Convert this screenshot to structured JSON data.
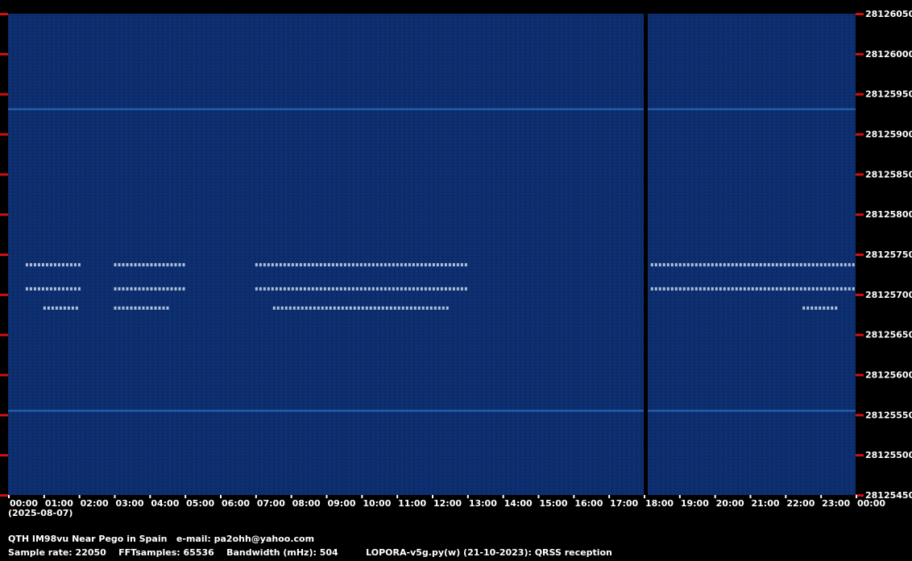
{
  "chart_data": {
    "type": "heatmap",
    "title": "",
    "xlabel": "",
    "ylabel": "",
    "x_tick_labels": [
      "00:00",
      "01:00",
      "02:00",
      "03:00",
      "04:00",
      "05:00",
      "06:00",
      "07:00",
      "08:00",
      "09:00",
      "10:00",
      "11:00",
      "12:00",
      "13:00",
      "14:00",
      "15:00",
      "16:00",
      "17:00",
      "18:00",
      "19:00",
      "20:00",
      "21:00",
      "22:00",
      "23:00",
      "00:00"
    ],
    "x_range_hours": [
      0,
      24
    ],
    "gap_hours": 18,
    "y_tick_labels": [
      "28126050",
      "28126000",
      "28125950",
      "28125900",
      "28125850",
      "28125800",
      "28125750",
      "28125700",
      "28125650",
      "28125600",
      "28125550",
      "28125500",
      "28125450"
    ],
    "y_range_hz": [
      28125450,
      28126050
    ],
    "date_label": "(2025-08-07)",
    "colors": {
      "background": "#0d2e6e",
      "signal": "#e8f2ff",
      "tick": "#d01010"
    },
    "signals": [
      {
        "freq_hz": 28125737,
        "hours": [
          [
            0.5,
            2.0
          ],
          [
            3.0,
            5.0
          ],
          [
            7.0,
            13.0
          ],
          [
            18.2,
            24.0
          ]
        ]
      },
      {
        "freq_hz": 28125707,
        "hours": [
          [
            0.5,
            2.0
          ],
          [
            3.0,
            5.0
          ],
          [
            7.0,
            13.0
          ],
          [
            18.2,
            24.0
          ]
        ]
      },
      {
        "freq_hz": 28125683,
        "hours": [
          [
            1.0,
            2.0
          ],
          [
            3.0,
            4.5
          ],
          [
            7.5,
            12.5
          ],
          [
            22.5,
            23.5
          ]
        ]
      },
      {
        "freq_hz": 28125931,
        "hours": [
          [
            0,
            24
          ]
        ]
      },
      {
        "freq_hz": 28125555,
        "hours": [
          [
            0,
            24
          ]
        ]
      }
    ]
  },
  "footer": {
    "qth": "QTH IM98vu Near Pego in Spain   e-mail: pa2ohh@yahoo.com",
    "sample_rate": "Sample rate: 22050",
    "fft_samples": "FFTsamples: 65536",
    "bandwidth": "Bandwidth (mHz): 504",
    "program": "LOPORA-v5g.py(w) (21-10-2023): QRSS reception"
  }
}
